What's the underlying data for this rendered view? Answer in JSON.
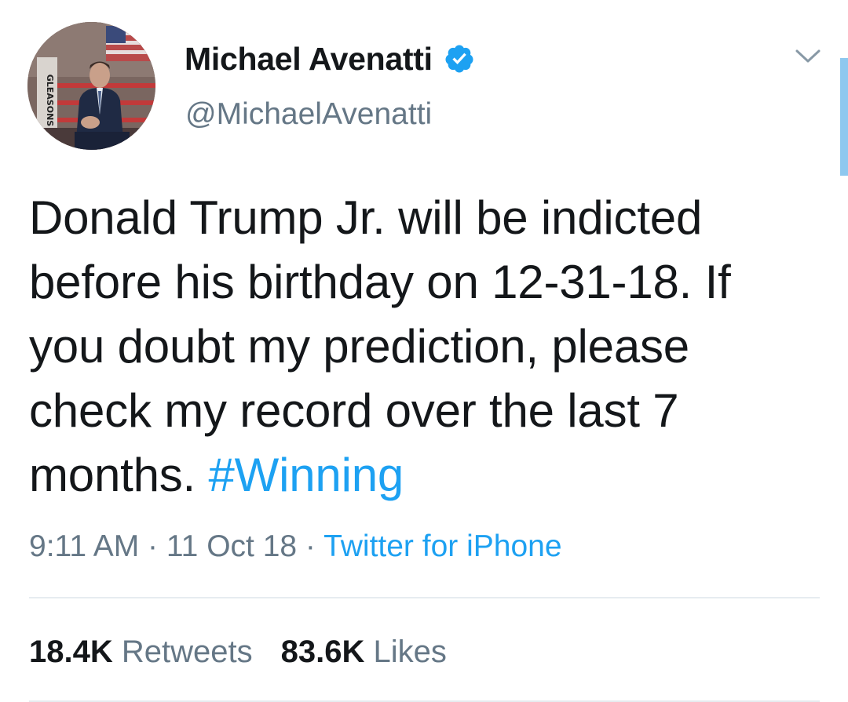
{
  "author": {
    "display_name": "Michael Avenatti",
    "handle": "@MichaelAvenatti",
    "verified": true,
    "avatar_icon": "profile-photo",
    "avatar_sign_text": "GLEASONS"
  },
  "tweet": {
    "text": "Donald Trump Jr. will be indicted\nbefore his birthday on 12-31-18. If\nyou doubt my prediction, please\ncheck my record over the last 7\nmonths. ",
    "hashtag": "#Winning",
    "time": "9:11 AM",
    "separator": " · ",
    "date": "11 Oct 18",
    "source": "Twitter for iPhone"
  },
  "stats": {
    "retweets_count": "18.4K",
    "retweets_label": "Retweets",
    "likes_count": "83.6K",
    "likes_label": "Likes"
  },
  "colors": {
    "link": "#1da1f2",
    "secondary_text": "#657786",
    "primary_text": "#14171a",
    "divider": "#e6ecf0",
    "scroll_indicator": "#8ec8ef"
  },
  "icons": {
    "verified": "verified-badge-icon",
    "menu": "chevron-down-icon"
  }
}
